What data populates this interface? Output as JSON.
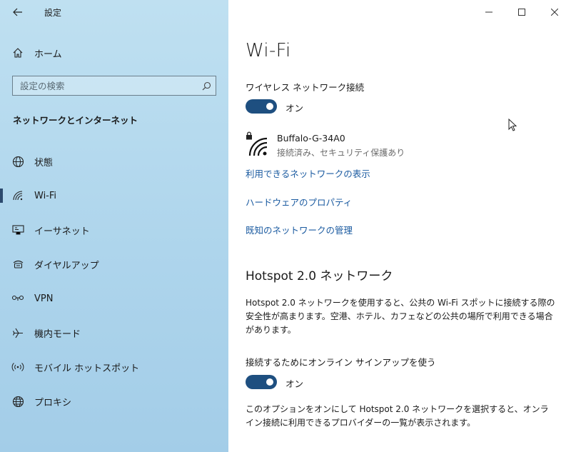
{
  "app": {
    "title": "設定"
  },
  "sidebar": {
    "home_label": "ホーム",
    "search_placeholder": "設定の検索",
    "section_heading": "ネットワークとインターネット",
    "items": [
      {
        "label": "状態",
        "icon": "globe-status-icon",
        "active": false
      },
      {
        "label": "Wi-Fi",
        "icon": "wifi-icon",
        "active": true
      },
      {
        "label": "イーサネット",
        "icon": "ethernet-icon",
        "active": false
      },
      {
        "label": "ダイヤルアップ",
        "icon": "dialup-icon",
        "active": false
      },
      {
        "label": "VPN",
        "icon": "vpn-icon",
        "active": false
      },
      {
        "label": "機内モード",
        "icon": "airplane-icon",
        "active": false
      },
      {
        "label": "モバイル ホットスポット",
        "icon": "hotspot-icon",
        "active": false
      },
      {
        "label": "プロキシ",
        "icon": "globe-icon",
        "active": false
      }
    ]
  },
  "main": {
    "title": "Wi-Fi",
    "wireless_label": "ワイヤレス ネットワーク接続",
    "wireless_toggle": "オン",
    "network": {
      "name": "Buffalo-G-34A0",
      "status": "接続済み、セキュリティ保護あり"
    },
    "links": [
      "利用できるネットワークの表示",
      "ハードウェアのプロパティ",
      "既知のネットワークの管理"
    ],
    "hotspot": {
      "title": "Hotspot 2.0 ネットワーク",
      "description": "Hotspot 2.0 ネットワークを使用すると、公共の Wi-Fi スポットに接続する際の安全性が高まります。空港、ホテル、カフェなどの公共の場所で利用できる場合があります。",
      "signup_label": "接続するためにオンライン サインアップを使う",
      "signup_toggle": "オン",
      "option_text": "このオプションをオンにして Hotspot 2.0 ネットワークを選択すると、オンライン接続に利用できるプロバイダーの一覧が表示されます。"
    }
  },
  "colors": {
    "accent": "#1e4f80",
    "link": "#1a5aa0",
    "sidebar_bg": "#b5d9ee"
  }
}
